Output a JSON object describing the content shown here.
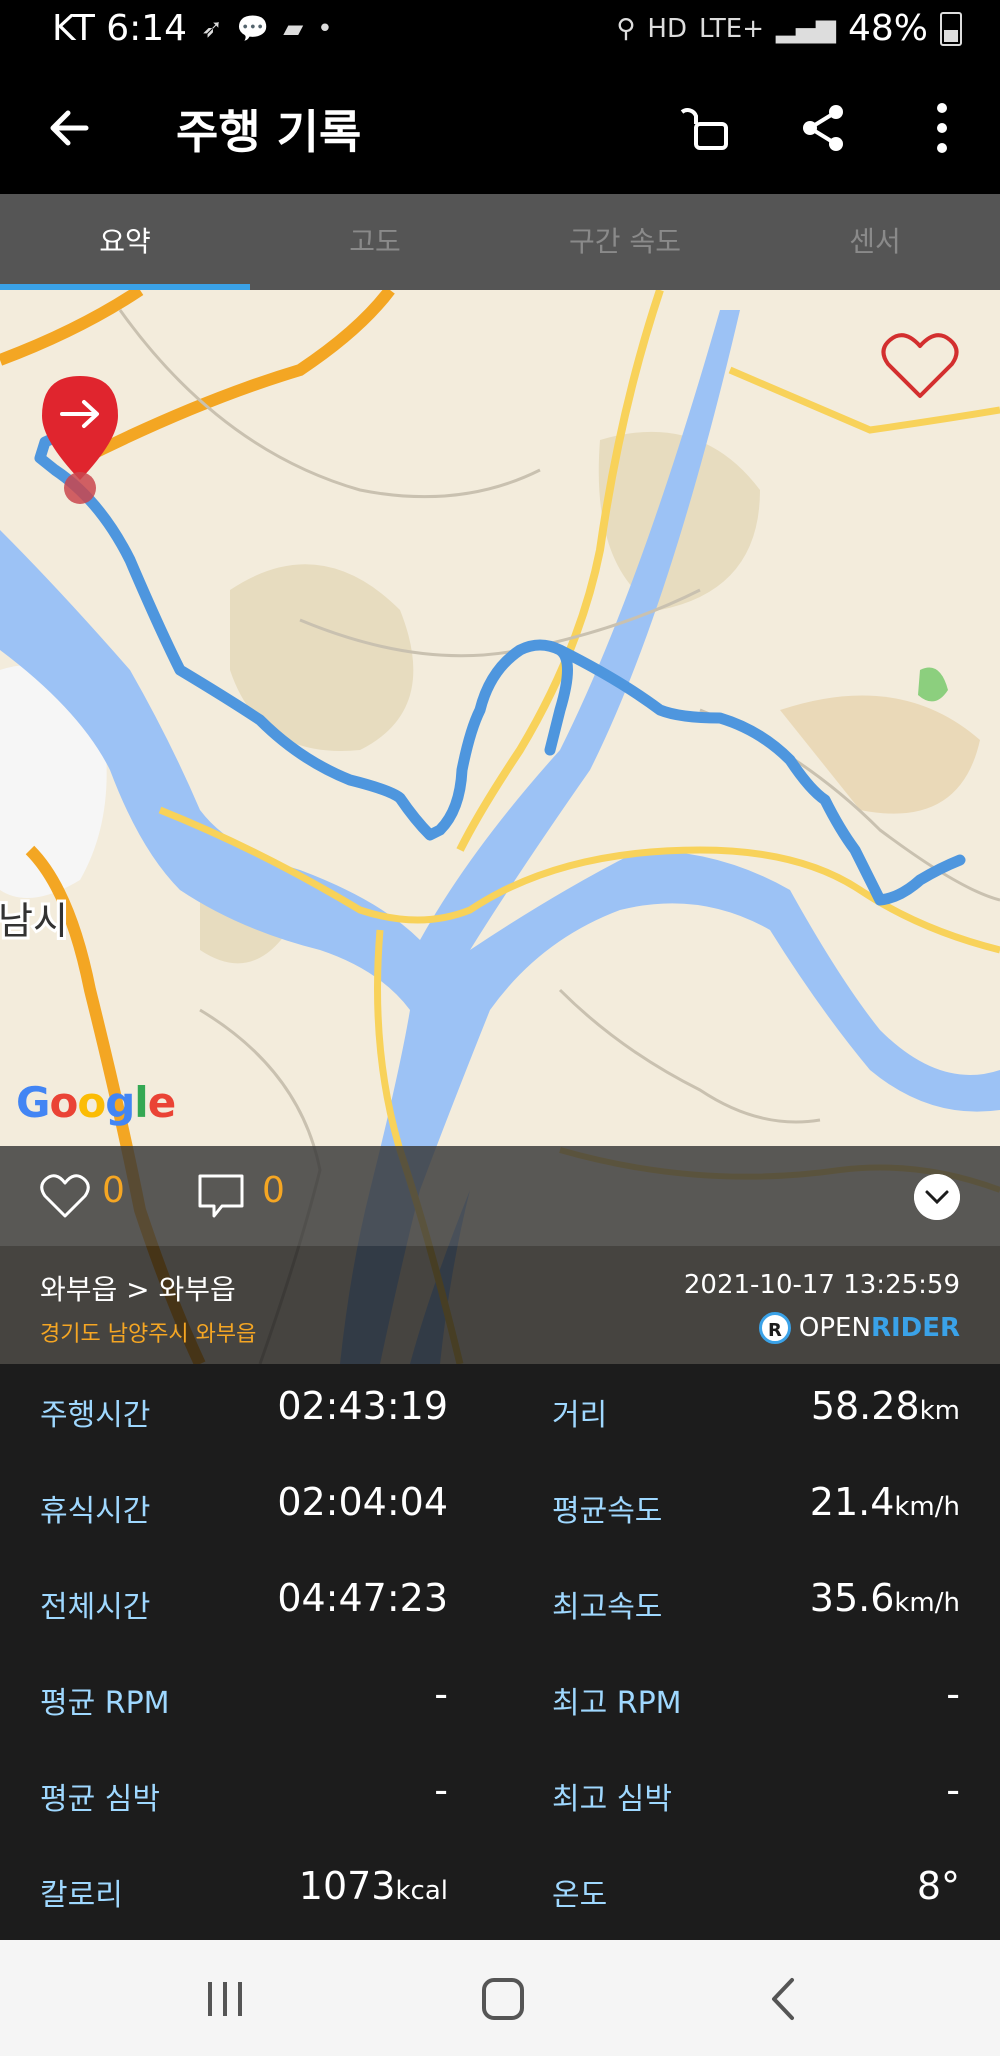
{
  "status_bar": {
    "carrier_time": "KT 6:14",
    "signal": "LTE+",
    "battery": "48%"
  },
  "app_bar": {
    "title": "주행 기록"
  },
  "tabs": [
    {
      "label": "요약",
      "active": true
    },
    {
      "label": "고도",
      "active": false
    },
    {
      "label": "구간 속도",
      "active": false
    },
    {
      "label": "센서",
      "active": false
    }
  ],
  "map": {
    "place_label": "남시",
    "attribution_letters": [
      "G",
      "o",
      "o",
      "g",
      "l",
      "e"
    ]
  },
  "social": {
    "likes": "0",
    "comments": "0"
  },
  "ride": {
    "route": "와부읍 > 와부읍",
    "address": "경기도 남양주시 와부읍",
    "datetime": "2021-10-17 13:25:59",
    "brand_open": "OPEN",
    "brand_rider": "RIDER",
    "brand_logo": "R"
  },
  "stats": [
    {
      "left_label": "주행시간",
      "left_value": "02:43:19",
      "left_unit": "",
      "right_label": "거리",
      "right_value": "58.28",
      "right_unit": "km"
    },
    {
      "left_label": "휴식시간",
      "left_value": "02:04:04",
      "left_unit": "",
      "right_label": "평균속도",
      "right_value": "21.4",
      "right_unit": "km/h"
    },
    {
      "left_label": "전체시간",
      "left_value": "04:47:23",
      "left_unit": "",
      "right_label": "최고속도",
      "right_value": "35.6",
      "right_unit": "km/h"
    },
    {
      "left_label": "평균 RPM",
      "left_value": "-",
      "left_unit": "",
      "right_label": "최고 RPM",
      "right_value": "-",
      "right_unit": ""
    },
    {
      "left_label": "평균 심박",
      "left_value": "-",
      "left_unit": "",
      "right_label": "최고 심박",
      "right_value": "-",
      "right_unit": ""
    },
    {
      "left_label": "칼로리",
      "left_value": "1073",
      "left_unit": "kcal",
      "right_label": "온도",
      "right_value": "8°",
      "right_unit": ""
    }
  ]
}
